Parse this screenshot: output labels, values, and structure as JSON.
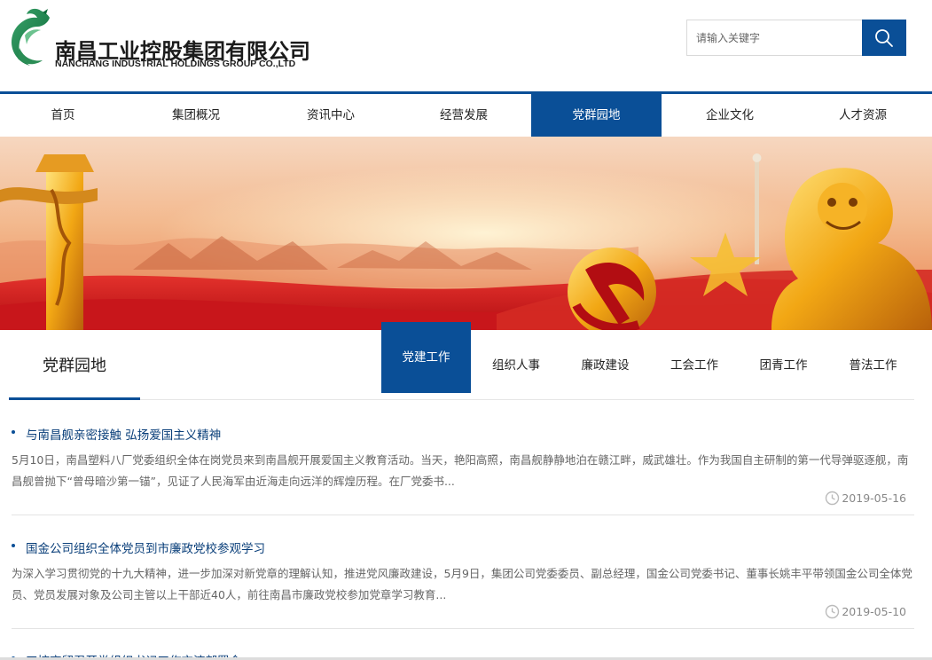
{
  "header": {
    "logo_cn": "南昌工业控股集团有限公司",
    "logo_en": "NANCHANG INDUSTRIAL HOLDINGS GROUP CO.,LTD",
    "search_placeholder": "请输入关键字",
    "search_icon": "search-icon",
    "brand_color": "#0a4f97"
  },
  "nav": {
    "items": [
      {
        "label": "首页"
      },
      {
        "label": "集团概况"
      },
      {
        "label": "资讯中心"
      },
      {
        "label": "经营发展"
      },
      {
        "label": "党群园地"
      },
      {
        "label": "企业文化"
      },
      {
        "label": "人才资源"
      }
    ],
    "active_index": 4
  },
  "section": {
    "title": "党群园地",
    "tabs": [
      {
        "label": "党建工作"
      },
      {
        "label": "组织人事"
      },
      {
        "label": "廉政建设"
      },
      {
        "label": "工会工作"
      },
      {
        "label": "团青工作"
      },
      {
        "label": "普法工作"
      }
    ],
    "active_tab": 0
  },
  "articles": [
    {
      "title": "与南昌舰亲密接触 弘扬爱国主义精神",
      "body": "5月10日，南昌塑料八厂党委组织全体在岗党员来到南昌舰开展爱国主义教育活动。当天，艳阳高照，南昌舰静静地泊在赣江畔，威武雄壮。作为我国自主研制的第一代导弹驱逐舰，南昌舰曾抛下“曾母暗沙第一锚”，见证了人民海军由近海走向远洋的辉煌历程。在厂党委书...",
      "date": "2019-05-16"
    },
    {
      "title": "国金公司组织全体党员到市廉政党校参观学习",
      "body": "为深入学习贯彻党的十九大精神，进一步加深对新党章的理解认知，推进党风廉政建设，5月9日，集团公司党委委员、副总经理，国金公司党委书记、董事长姚丰平带领国金公司全体党员、党员发展对象及公司主管以上干部近40人，前往南昌市廉政党校参加党章学习教育...",
      "date": "2019-05-10"
    },
    {
      "title": "工控商留召开党组织书记工作交流部署会",
      "body": "",
      "date": ""
    }
  ]
}
